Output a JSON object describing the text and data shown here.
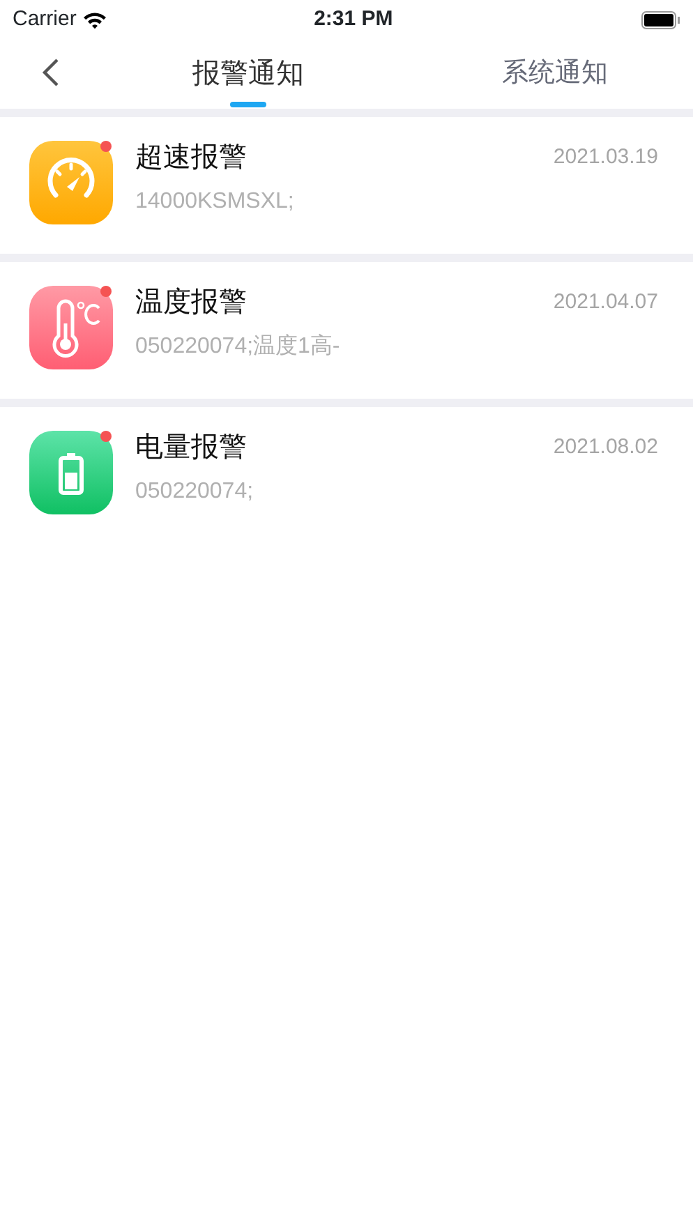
{
  "status_bar": {
    "carrier": "Carrier",
    "time": "2:31 PM"
  },
  "tabs": [
    {
      "label": "报警通知",
      "selected": true
    },
    {
      "label": "系统通知",
      "selected": false
    }
  ],
  "alerts": [
    {
      "kind": "speed",
      "title": "超速报警",
      "date": "2021.03.19",
      "detail": "14000KSMSXL;",
      "unread": true
    },
    {
      "kind": "temperature",
      "title": "温度报警",
      "date": "2021.04.07",
      "detail": "050220074;温度1高-",
      "unread": true
    },
    {
      "kind": "battery",
      "title": "电量报警",
      "date": "2021.08.02",
      "detail": "050220074;",
      "unread": true
    }
  ]
}
